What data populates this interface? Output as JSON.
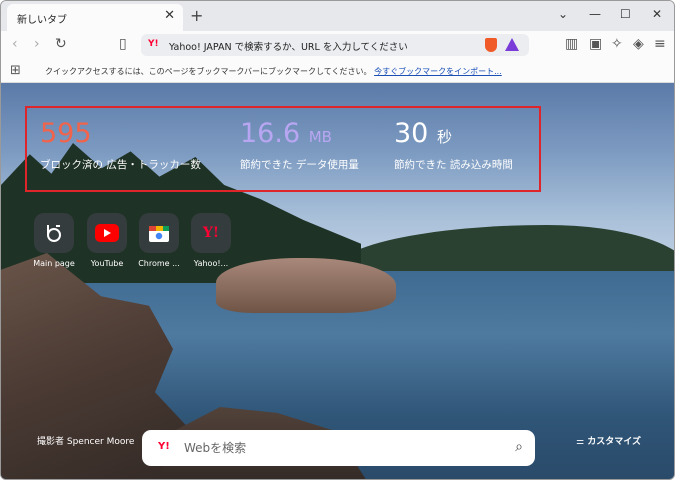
{
  "tab": {
    "title": "新しいタブ"
  },
  "toolbar": {
    "address_text": "Yahoo! JAPAN で検索するか、URL を入力してください",
    "address_icon": "Y!"
  },
  "bookmark_bar": {
    "message": "クイックアクセスするには、このページをブックマークバーにブックマークしてください。",
    "link": "今すぐブックマークをインポート..."
  },
  "stats": {
    "ads": {
      "value": "595",
      "unit": "",
      "label": "ブロック済の 広告・トラッカー数"
    },
    "data": {
      "value": "16.6",
      "unit": "MB",
      "label": "節約できた データ使用量"
    },
    "time": {
      "value": "30",
      "unit": "秒",
      "label": "節約できた 読み込み時間"
    }
  },
  "top_sites": [
    {
      "label": "Main page"
    },
    {
      "label": "YouTube"
    },
    {
      "label": "Chrome ..."
    },
    {
      "label": "Yahoo!..."
    }
  ],
  "photo_credit": "撮影者 Spencer Moore",
  "customize_label": "カスタマイズ",
  "search": {
    "placeholder": "Webを検索",
    "icon": "Y!"
  },
  "colors": {
    "ads_value": "#f1634a",
    "data_value": "#b9a6f2",
    "highlight_border": "#e0252a",
    "yahoo_red": "#ff0033"
  }
}
